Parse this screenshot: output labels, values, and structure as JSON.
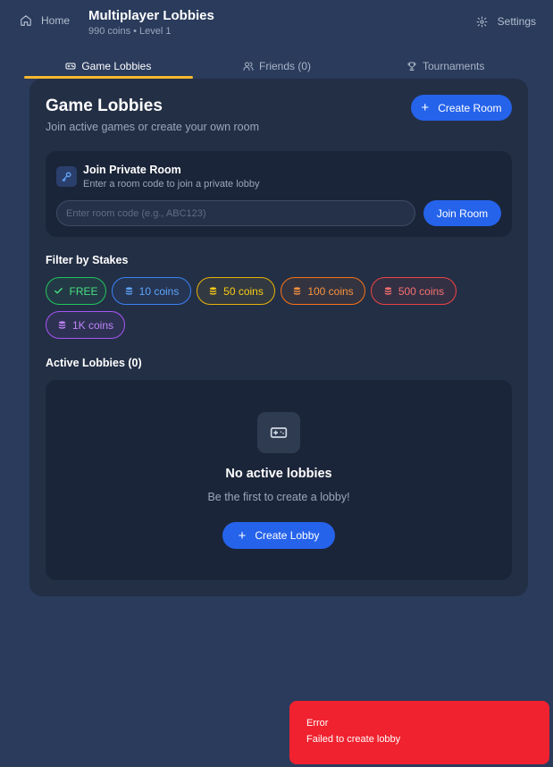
{
  "header": {
    "home_label": "Home",
    "title": "Multiplayer Lobbies",
    "subtitle": "990 coins • Level 1",
    "settings_label": "Settings"
  },
  "tabs": [
    {
      "label": "Game Lobbies",
      "icon": "gamepad-icon",
      "active": true
    },
    {
      "label": "Friends (0)",
      "icon": "users-icon",
      "active": false
    },
    {
      "label": "Tournaments",
      "icon": "trophy-icon",
      "active": false
    }
  ],
  "main": {
    "title": "Game Lobbies",
    "subtitle": "Join active games or create your own room",
    "create_room_label": "Create Room"
  },
  "private_room": {
    "title": "Join Private Room",
    "subtitle": "Enter a room code to join a private lobby",
    "input_placeholder": "Enter room code (e.g., ABC123)",
    "input_value": "",
    "join_label": "Join Room"
  },
  "filter": {
    "label": "Filter by Stakes",
    "chips": [
      {
        "label": "FREE",
        "icon": "check-icon",
        "color": "#22c55e"
      },
      {
        "label": "10 coins",
        "icon": "coins-icon",
        "color": "#3b82f6"
      },
      {
        "label": "50 coins",
        "icon": "coins-icon",
        "color": "#eab308"
      },
      {
        "label": "100 coins",
        "icon": "coins-icon",
        "color": "#f97316"
      },
      {
        "label": "500 coins",
        "icon": "coins-icon",
        "color": "#ef4444"
      },
      {
        "label": "1K coins",
        "icon": "coins-icon",
        "color": "#a855f7"
      }
    ]
  },
  "lobbies": {
    "label": "Active Lobbies (0)",
    "empty_title": "No active lobbies",
    "empty_subtitle": "Be the first to create a lobby!",
    "create_lobby_label": "Create Lobby"
  },
  "toast": {
    "title": "Error",
    "message": "Failed to create lobby",
    "color": "#f0222f"
  },
  "colors": {
    "background": "#2a3b5c",
    "panel": "#232f45",
    "accent": "#2563eb",
    "tab_indicator": "#f5b82e"
  }
}
